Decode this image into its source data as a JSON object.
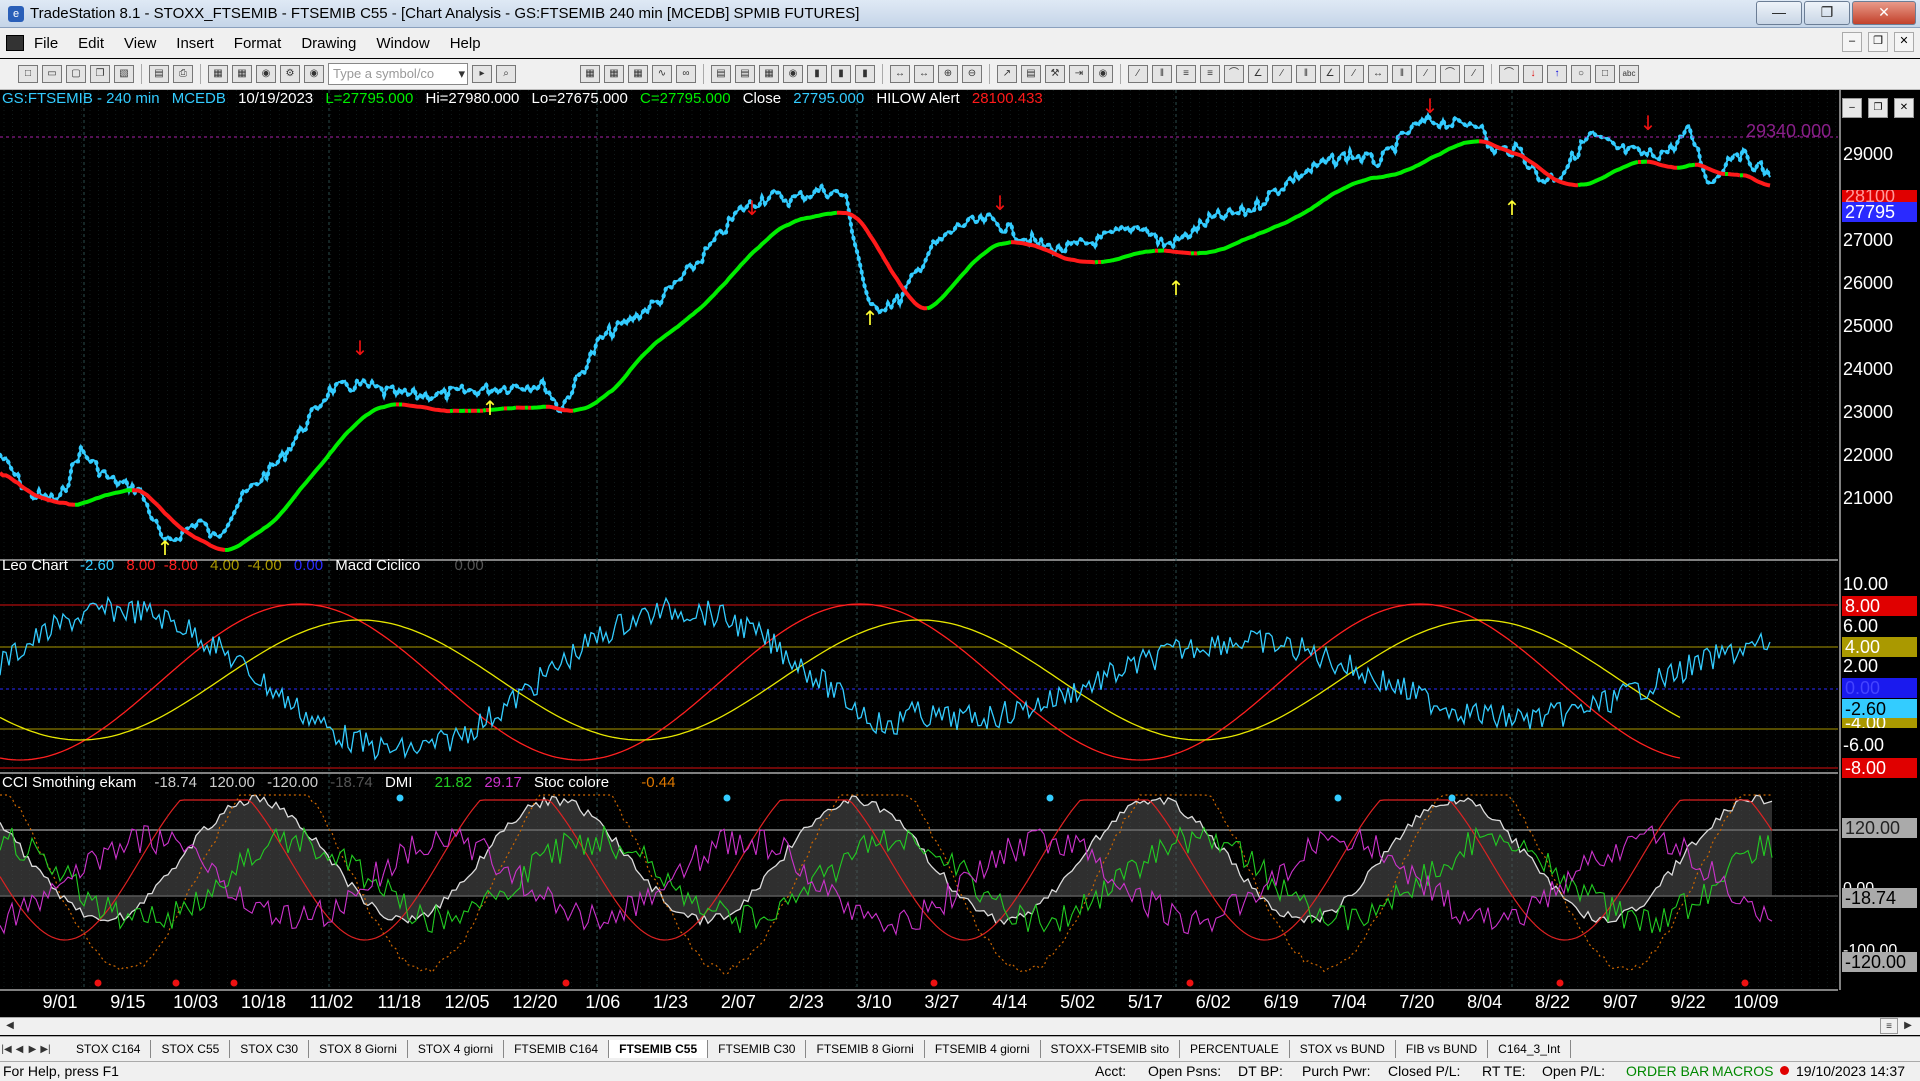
{
  "window": {
    "title": "TradeStation 8.1 - STOXX_FTSEMIB - FTSEMIB C55 - [Chart Analysis - GS:FTSEMIB  240 min  [MCEDB] SPMIB FUTURES]"
  },
  "menu": [
    "File",
    "Edit",
    "View",
    "Insert",
    "Format",
    "Drawing",
    "Window",
    "Help"
  ],
  "toolbar": {
    "symbol_placeholder": "Type a symbol/co"
  },
  "price_panel": {
    "symbol": "GS:FTSEMIB - 240 min",
    "session": "MCEDB",
    "date": "10/19/2023",
    "last": "L=27795.000",
    "high": "Hi=27980.000",
    "low": "Lo=27675.000",
    "close": "C=27795.000",
    "close_label": "Close",
    "close_value": "27795.000",
    "alert_label": "HILOW Alert",
    "alert_value": "28100.433",
    "overlay_value": "29340.000",
    "y_ticks": [
      "29000",
      "28000",
      "27000",
      "26000",
      "25000",
      "24000",
      "23000",
      "22000",
      "21000"
    ],
    "badge_red": "28100",
    "badge_current": "27795"
  },
  "leo_panel": {
    "name": "Leo Chart",
    "v1": "-2.60",
    "v2": "8.00",
    "v3": "-8.00",
    "v4": "4.00",
    "v5": "-4.00",
    "v6": "0.00",
    "macd_name": "Macd Ciclico",
    "macd_value": "0.00",
    "y_ticks": [
      "10.00",
      "6.00",
      "2.00",
      "-6.00"
    ],
    "badges": {
      "b8": "8.00",
      "b4": "4.00",
      "b0": "0.00",
      "bcur": "-2.60",
      "bm4": "-4.00",
      "bm8": "-8.00"
    }
  },
  "cci_panel": {
    "name": "CCI Smothing ekam",
    "v1": "-18.74",
    "v2": "120.00",
    "v3": "-120.00",
    "v4": "-18.74",
    "dmi_name": "DMI",
    "dmi_plus": "21.82",
    "dmi_minus": "29.17",
    "stoc_name": "Stoc colore",
    "stoc_value": "-0.44",
    "badges": {
      "b120": "120.00",
      "b0": "0.00",
      "bcur": "-18.74",
      "bm100": "-100.00",
      "bm120": "-120.00"
    }
  },
  "date_ticks": [
    "9/01",
    "9/15",
    "10/03",
    "10/18",
    "11/02",
    "11/18",
    "12/05",
    "12/20",
    "1/06",
    "1/23",
    "2/07",
    "2/23",
    "3/10",
    "3/27",
    "4/14",
    "5/02",
    "5/17",
    "6/02",
    "6/19",
    "7/04",
    "7/20",
    "8/04",
    "8/22",
    "9/07",
    "9/22",
    "10/09"
  ],
  "tabs": [
    "STOX C164",
    "STOX C55",
    "STOX  C30",
    "STOX  8 Giorni",
    "STOX 4 giorni",
    "FTSEMIB C164",
    "FTSEMIB C55",
    "FTSEMIB C30",
    "FTSEMIB  8 Giorni",
    "FTSEMIB  4 giorni",
    "STOXX-FTSEMIB sito",
    "PERCENTUALE",
    "STOX vs BUND",
    "FIB vs BUND",
    "C164_3_Int"
  ],
  "active_tab": "FTSEMIB C55",
  "status": {
    "help": "For Help, press F1",
    "acct": "Acct:",
    "open_psns": "Open Psns:",
    "dt_bp": "DT BP:",
    "purch_pwr": "Purch Pwr:",
    "closed_pl": "Closed P/L:",
    "rt_te": "RT TE:",
    "open_pl": "Open P/L:",
    "order_bar": "ORDER BAR",
    "macros": "MACROS",
    "datetime": "19/10/2023 14:37"
  },
  "colors": {
    "cyan": "#33ccff",
    "green": "#00ee00",
    "red": "#ff1a1a",
    "yellow": "#e6e600",
    "magenta": "#dd33dd"
  }
}
